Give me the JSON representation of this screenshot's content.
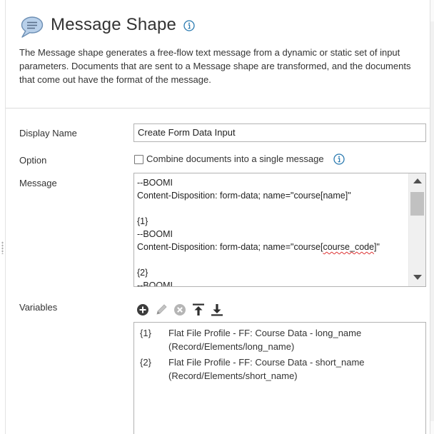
{
  "panel": {
    "title": "Message Shape",
    "description": [
      "The Message shape generates a free-flow text message from a dynamic or static set of input",
      "parameters. Documents that are sent to a Message shape are transformed, and the documents",
      "that come out have the format of the message."
    ]
  },
  "form": {
    "display_name_label": "Display Name",
    "display_name_value": "Create Form Data Input",
    "option_label": "Option",
    "combine_label": "Combine documents into a single message",
    "combine_checked": false,
    "message_label": "Message",
    "message_lines": [
      "--BOOMI",
      "Content-Disposition: form-data; name=\"course[name]\"",
      "",
      "{1}",
      "--BOOMI",
      "Content-Disposition: form-data; name=\"course[",
      "{2}",
      "--BOOMI"
    ],
    "message_line6_spell": "course_code",
    "message_line6_tail": "]\"",
    "variables_label": "Variables",
    "variables": [
      {
        "key": "{1}",
        "line1": "Flat File Profile - FF: Course Data - long_name",
        "line2": "(Record/Elements/long_name)"
      },
      {
        "key": "{2}",
        "line1": "Flat File Profile - FF: Course Data - short_name",
        "line2": "(Record/Elements/short_name)"
      }
    ]
  },
  "icons": {
    "shape": "speech-bubble-icon",
    "info": "info-icon",
    "add": "add-icon",
    "edit": "pencil-icon",
    "delete": "delete-icon",
    "move_top": "move-to-top-icon",
    "move_bottom": "move-to-bottom-icon"
  },
  "colors": {
    "info_blue": "#2a7ab0",
    "bubble_fill": "#b8d0ea",
    "toolbar_dark": "#3c3c3c",
    "toolbar_disabled": "#b5b5b5"
  }
}
